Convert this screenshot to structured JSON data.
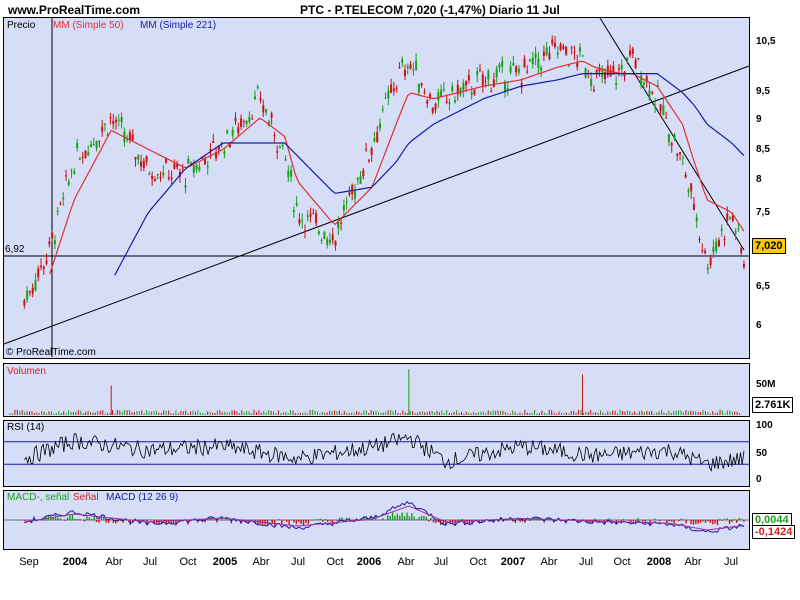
{
  "header": {
    "site": "www.ProRealTime.com",
    "title": "PTC - P.TELECOM    7,020 (-1,47%)   Diario  11 Jul"
  },
  "price_panel": {
    "label_price": "Precio",
    "label_ma50": "MM (Simple 50)",
    "label_ma221": "MM (Simple 221)",
    "watermark": "© ProRealTime.com",
    "level_label": "6,92",
    "last_price": "7,020",
    "y_ticks": [
      "10,5",
      "10",
      "9,5",
      "9",
      "8,5",
      "8",
      "7,5",
      "7",
      "6,5",
      "6"
    ]
  },
  "volume_panel": {
    "label": "Volumen",
    "y_tick": "50M",
    "last_value": "2.761K"
  },
  "rsi_panel": {
    "label": "RSI (14)",
    "y_ticks": [
      "100",
      "50",
      "0"
    ]
  },
  "macd_panel": {
    "label_a": "MACD-, señal",
    "label_b": "Señal",
    "label_c": "MACD (12 26 9)",
    "value_a": "0,0044",
    "value_b": "-0,1424"
  },
  "x_axis": [
    "Sep",
    "2004",
    "Abr",
    "Jul",
    "Oct",
    "2005",
    "Abr",
    "Jul",
    "Oct",
    "2006",
    "Abr",
    "Jul",
    "Oct",
    "2007",
    "Abr",
    "Jul",
    "Oct",
    "2008",
    "Abr",
    "Jul"
  ],
  "colors": {
    "pane_bg": "#d5ddf7",
    "ma50": "#e03030",
    "ma221": "#1a1aa8",
    "up_candle": "#18a018",
    "down_candle": "#cc1111",
    "trendline": "#000000",
    "price_box": "#ffcc00"
  },
  "chart_data": [
    {
      "type": "line",
      "title": "PTC - P.TELECOM",
      "ylim": [
        5.7,
        10.7
      ],
      "x": [
        "2003-09",
        "2003-11",
        "2004-01",
        "2004-04",
        "2004-07",
        "2004-10",
        "2005-01",
        "2005-04",
        "2005-06",
        "2005-07",
        "2005-10",
        "2006-01",
        "2006-03",
        "2006-04",
        "2006-06",
        "2006-10",
        "2007-01",
        "2007-04",
        "2007-06",
        "2007-07",
        "2007-09",
        "2007-10",
        "2007-12",
        "2008-02",
        "2008-03",
        "2008-04",
        "2008-06",
        "2008-07"
      ],
      "series": [
        {
          "name": "Precio",
          "values": [
            6.4,
            7.2,
            8.6,
            9.3,
            8.5,
            8.4,
            8.9,
            9.6,
            8.7,
            7.8,
            7.4,
            8.9,
            9.9,
            10.2,
            9.5,
            9.9,
            10.0,
            10.4,
            10.2,
            9.9,
            10.0,
            10.3,
            9.6,
            8.6,
            7.9,
            7.0,
            7.8,
            7.02
          ]
        },
        {
          "name": "MM (Simple 50)",
          "values": [
            null,
            6.8,
            8.0,
            9.1,
            8.8,
            8.5,
            8.8,
            9.3,
            9.0,
            8.3,
            7.6,
            8.2,
            9.2,
            9.7,
            9.6,
            9.8,
            9.9,
            10.1,
            10.2,
            10.1,
            10.0,
            10.0,
            9.8,
            9.2,
            8.6,
            8.0,
            7.8,
            7.5
          ]
        },
        {
          "name": "MM (Simple 221)",
          "values": [
            null,
            null,
            null,
            6.7,
            7.8,
            8.5,
            8.9,
            8.9,
            8.9,
            8.7,
            8.1,
            8.2,
            8.6,
            8.9,
            9.2,
            9.6,
            9.8,
            9.9,
            10.0,
            10.0,
            10.0,
            10.0,
            10.0,
            9.7,
            9.5,
            9.2,
            8.9,
            8.7
          ]
        }
      ]
    },
    {
      "type": "bar",
      "title": "Volumen",
      "ylim": [
        0,
        75
      ],
      "x": [
        "2004-04",
        "2006-04",
        "2007-06"
      ],
      "values": [
        45,
        70,
        62
      ]
    },
    {
      "type": "line",
      "title": "RSI (14)",
      "ylim": [
        0,
        100
      ],
      "x": [
        "2003-09",
        "2004-01",
        "2004-07",
        "2005-01",
        "2005-07",
        "2006-01",
        "2006-04",
        "2006-07",
        "2007-01",
        "2007-07",
        "2008-01",
        "2008-04",
        "2008-07"
      ],
      "series": [
        {
          "name": "RSI (14)",
          "values": [
            40,
            72,
            55,
            62,
            40,
            60,
            78,
            35,
            62,
            45,
            55,
            30,
            40
          ]
        }
      ]
    },
    {
      "type": "line",
      "title": "MACD (12 26 9)",
      "x": [
        "2003-09",
        "2004-01",
        "2004-07",
        "2005-01",
        "2005-07",
        "2006-01",
        "2006-04",
        "2006-07",
        "2007-01",
        "2007-07",
        "2008-01",
        "2008-04",
        "2008-07"
      ],
      "series": [
        {
          "name": "MACD",
          "values": [
            -0.05,
            0.2,
            -0.1,
            0.05,
            -0.2,
            0.05,
            0.45,
            -0.1,
            0.05,
            -0.05,
            -0.1,
            -0.3,
            -0.14
          ]
        },
        {
          "name": "Señal",
          "values": [
            -0.05,
            0.15,
            -0.05,
            0.05,
            -0.15,
            0.02,
            0.35,
            -0.05,
            0.04,
            -0.03,
            -0.08,
            -0.25,
            -0.14
          ]
        }
      ]
    }
  ]
}
